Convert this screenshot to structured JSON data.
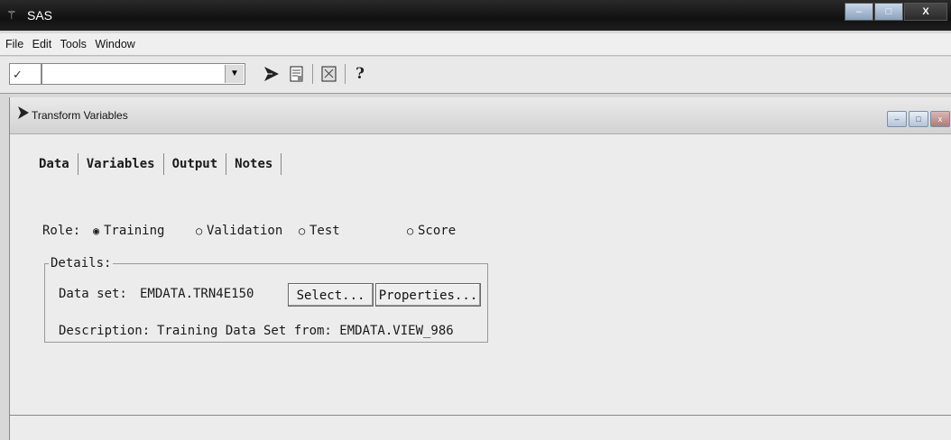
{
  "window": {
    "title": "SAS",
    "app_icon": "sas-icon",
    "controls": {
      "minimize": "–",
      "maximize": "□",
      "close": "X"
    }
  },
  "menu": {
    "items": [
      "File",
      "Edit",
      "Tools",
      "Window"
    ]
  },
  "toolbar": {
    "check_glyph": "✓",
    "combo_value": "",
    "combo_arrow": "▼",
    "icons": [
      "run-icon",
      "new-icon",
      "options-icon",
      "help-icon"
    ],
    "help_glyph": "?"
  },
  "subwindow": {
    "title": "Transform Variables",
    "controls": {
      "minimize": "–",
      "maximize": "□",
      "close": "x"
    }
  },
  "tabs": [
    "Data",
    "Variables",
    "Output",
    "Notes"
  ],
  "role": {
    "label": "Role:",
    "options": [
      {
        "label": "Training",
        "selected": true
      },
      {
        "label": "Validation",
        "selected": false
      },
      {
        "label": "Test",
        "selected": false
      },
      {
        "label": "Score",
        "selected": false
      }
    ]
  },
  "details": {
    "legend": "Details:",
    "dataset_label": "Data set:",
    "dataset_value": "EMDATA.TRN4E150",
    "select_button": "Select...",
    "properties_button": "Properties...",
    "description_label": "Description:",
    "description_value": "Training Data Set from: EMDATA.VIEW_986"
  }
}
